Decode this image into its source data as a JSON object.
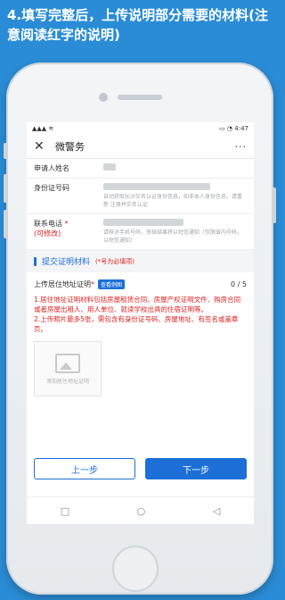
{
  "caption": "4.填写完整后，上传说明部分需要的材料(注意阅读红字的说明)",
  "status": {
    "left": "▲▲▲ ≋",
    "right": "▭ ◔ 4:47"
  },
  "appbar": {
    "close": "✕",
    "title": "微警务",
    "more": "···"
  },
  "form": {
    "name_label": "申请人姓名",
    "id_label": "身份证号码",
    "id_hint": "自动获取长沙实名认证身份信息，如非本人身份信息，请重新 注册并实名认证",
    "phone_label": "联系电话",
    "phone_required": " *",
    "phone_editable": "(可修改)",
    "phone_hint": "请核对手机号码，审核结果将以短信通知（仅限省内号码，以短信通知）"
  },
  "section": {
    "title": "提交证明材料",
    "note": "(*号为必填项)"
  },
  "upload": {
    "label": "上传居住地址证明",
    "required": " *",
    "example": "查看例图",
    "count": "0 / 5",
    "notes": [
      "1.居住地址证明材料包括房屋租赁合同、房屋产权证明文件、购房合同或者房屋出租人、用人单位、就读学校出具的住宿证明等。",
      "2.上传照片最多5张，需包含有身份证号码、房屋地址、有签名或盖章页。"
    ],
    "placeholder": "添加居住地址证明"
  },
  "buttons": {
    "prev": "上一步",
    "next": "下一步"
  },
  "nav": {
    "back": "◁",
    "home": "○",
    "recent": "□"
  },
  "colors": {
    "background": "#2a8cd6",
    "accent": "#1b6fd6",
    "required": "#e02020"
  }
}
